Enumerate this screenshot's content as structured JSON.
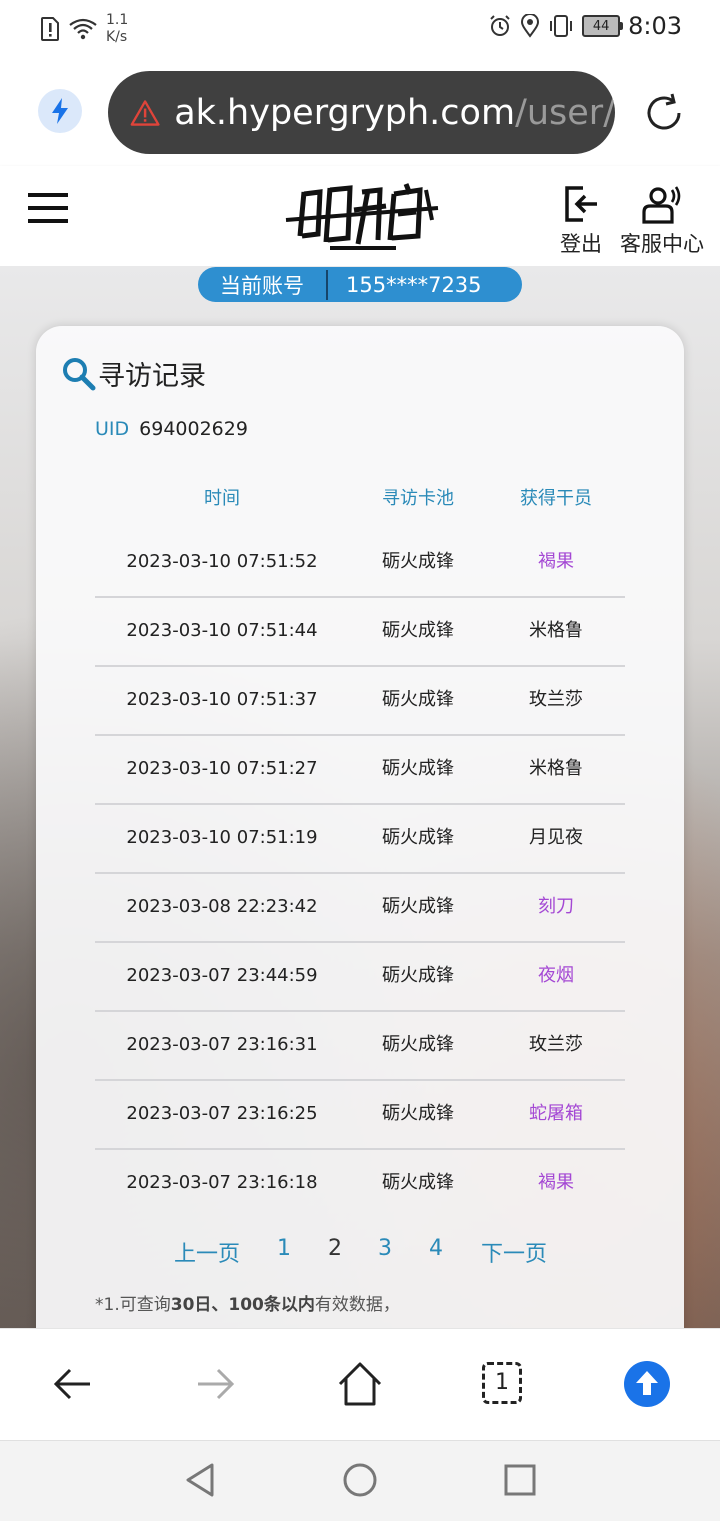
{
  "status_bar": {
    "speed_value": "1.1",
    "speed_unit": "K/s",
    "battery": "44",
    "time": "8:03"
  },
  "browser": {
    "url_host": "ak.hypergryph.com",
    "url_path": "/user/"
  },
  "header": {
    "logout_label": "登出",
    "support_label": "客服中心"
  },
  "account": {
    "label": "当前账号",
    "value": "155****7235"
  },
  "records": {
    "title": "寻访记录",
    "uid_label": "UID",
    "uid_value": "694002629",
    "columns": [
      "时间",
      "寻访卡池",
      "获得干员"
    ],
    "rows": [
      {
        "time": "2023-03-10 07:51:52",
        "pool": "砺火成锋",
        "operator": "褐果",
        "highlight": true
      },
      {
        "time": "2023-03-10 07:51:44",
        "pool": "砺火成锋",
        "operator": "米格鲁",
        "highlight": false
      },
      {
        "time": "2023-03-10 07:51:37",
        "pool": "砺火成锋",
        "operator": "玫兰莎",
        "highlight": false
      },
      {
        "time": "2023-03-10 07:51:27",
        "pool": "砺火成锋",
        "operator": "米格鲁",
        "highlight": false
      },
      {
        "time": "2023-03-10 07:51:19",
        "pool": "砺火成锋",
        "operator": "月见夜",
        "highlight": false
      },
      {
        "time": "2023-03-08 22:23:42",
        "pool": "砺火成锋",
        "operator": "刻刀",
        "highlight": true
      },
      {
        "time": "2023-03-07 23:44:59",
        "pool": "砺火成锋",
        "operator": "夜烟",
        "highlight": true
      },
      {
        "time": "2023-03-07 23:16:31",
        "pool": "砺火成锋",
        "operator": "玫兰莎",
        "highlight": false
      },
      {
        "time": "2023-03-07 23:16:25",
        "pool": "砺火成锋",
        "operator": "蛇屠箱",
        "highlight": true
      },
      {
        "time": "2023-03-07 23:16:18",
        "pool": "砺火成锋",
        "operator": "褐果",
        "highlight": true
      }
    ],
    "pagination": {
      "prev": "上一页",
      "pages": [
        "1",
        "2",
        "3",
        "4"
      ],
      "current": "2",
      "next": "下一页"
    },
    "note": {
      "prefix": "*1.可查询",
      "bold": "30日、100条以内",
      "suffix": "有效数据，"
    }
  },
  "colors": {
    "accent": "#2a8ab8",
    "account_pill": "#2e8fd0",
    "highlight_operator": "#a448d4",
    "scroll_top_button": "#1a73e8"
  },
  "icons": {
    "lightning": "bolt-icon",
    "warning": "warning-icon",
    "reload": "reload-icon",
    "menu": "hamburger-icon",
    "logout": "logout-icon",
    "support": "support-icon",
    "search": "search-icon"
  },
  "bottom_nav": {
    "tab_count": "1"
  }
}
